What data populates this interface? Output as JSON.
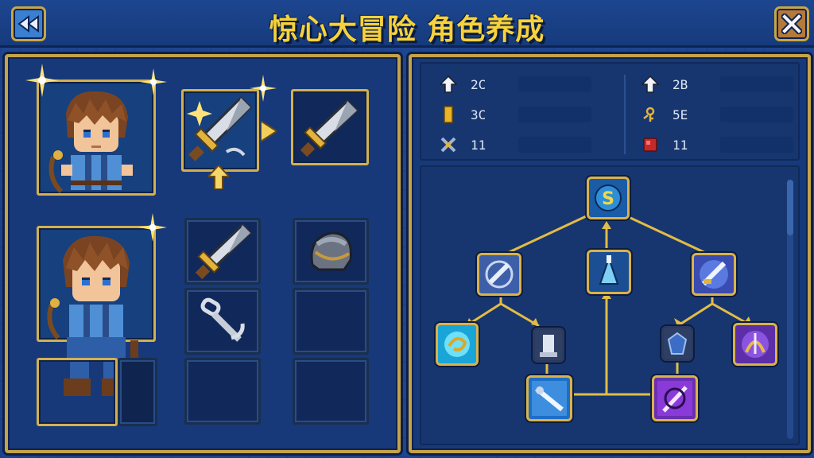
{
  "header": {
    "title": "惊心大冒险 角色养成",
    "back_icon": "rewind-icon",
    "close_icon": "close-icon"
  },
  "equipment": {
    "characters": [
      {
        "portrait": "hero-portrait-icon",
        "selected": true
      },
      {
        "portrait": "hero-fullbody-icon",
        "selected": false
      }
    ],
    "items": [
      {
        "icon": "sword-icon",
        "state": "upgradable"
      },
      {
        "icon": "sword-icon",
        "state": "upgrade-result"
      },
      {
        "icon": "sword-icon",
        "state": "equipped"
      },
      {
        "icon": "helmet-icon",
        "state": "equipped"
      },
      {
        "icon": "chain-icon",
        "state": "equipped"
      }
    ]
  },
  "stats": {
    "left": [
      {
        "icon": "arrow-up-icon",
        "value": "2C"
      },
      {
        "icon": "gold-bar-icon",
        "value": "3C"
      },
      {
        "icon": "cross-shield-icon",
        "value": "11"
      }
    ],
    "right": [
      {
        "icon": "arrow-up-icon",
        "value": "2B"
      },
      {
        "icon": "key-icon",
        "value": "5E"
      },
      {
        "icon": "red-gem-icon",
        "value": "11"
      }
    ]
  },
  "skill_tree": {
    "root_label": "S",
    "nodes": [
      "root-skill",
      "blade-skill",
      "spire-skill",
      "slash-skill",
      "swirl-skill",
      "tower-skill",
      "gem-skill",
      "bow-skill",
      "lance-skill",
      "void-skill"
    ]
  },
  "colors": {
    "accent_gold": "#d8b24d",
    "title_yellow": "#f6d23c",
    "panel_blue": "#17397a"
  }
}
